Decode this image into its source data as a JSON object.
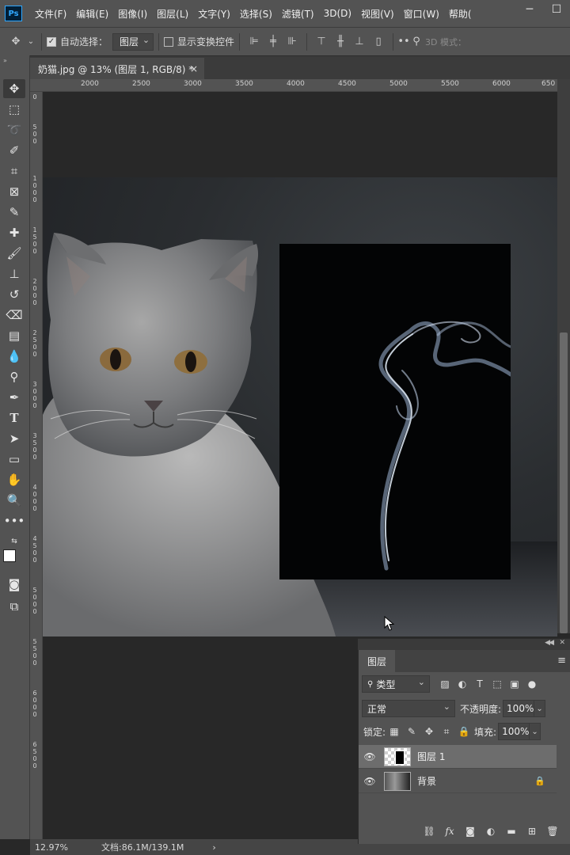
{
  "app": {
    "logo": "Ps"
  },
  "menu": [
    "文件(F)",
    "编辑(E)",
    "图像(I)",
    "图层(L)",
    "文字(Y)",
    "选择(S)",
    "滤镜(T)",
    "3D(D)",
    "视图(V)",
    "窗口(W)",
    "帮助("
  ],
  "window_controls": {
    "minimize": "─",
    "maximize": "☐"
  },
  "options": {
    "auto_select_label": "自动选择：",
    "auto_select_checked": true,
    "auto_select_target": "图层",
    "show_transform_label": "显示变换控件",
    "mode_3d_label": "3D 模式："
  },
  "document": {
    "tab_title": "奶猫.jpg @ 13% (图层 1, RGB/8) *",
    "close": "×"
  },
  "ruler": {
    "top_labels": [
      "2000",
      "2500",
      "3000",
      "3500",
      "4000",
      "4500",
      "5000",
      "5500",
      "6000",
      "650"
    ],
    "left_labels": [
      "0",
      "5\n0\n0",
      "1\n0\n0\n0",
      "1\n5\n0\n0",
      "2\n0\n0\n0",
      "2\n5\n0\n0",
      "3\n0\n0\n0",
      "3\n5\n0\n0",
      "4\n0\n0\n0",
      "4\n5\n0\n0",
      "5\n0\n0\n0",
      "5\n5\n0\n0",
      "6\n0\n0\n0",
      "6\n5\n0\n0"
    ]
  },
  "status": {
    "zoom": "12.97%",
    "doc_size": "文档:86.1M/139.1M",
    "arrow": "›"
  },
  "layers_panel": {
    "tab_label": "图层",
    "filter_label": "类型",
    "blend_mode": "正常",
    "opacity_label": "不透明度:",
    "opacity_value": "100%",
    "lock_label": "锁定:",
    "fill_label": "填充:",
    "fill_value": "100%",
    "layers": [
      {
        "name": "图层 1",
        "selected": true,
        "visible": true,
        "locked": false
      },
      {
        "name": "背景",
        "selected": false,
        "visible": true,
        "locked": true
      }
    ]
  },
  "colors": {
    "ui_dark": "#535353",
    "canvas_bg": "#282828",
    "accent": "#31a8ff"
  }
}
